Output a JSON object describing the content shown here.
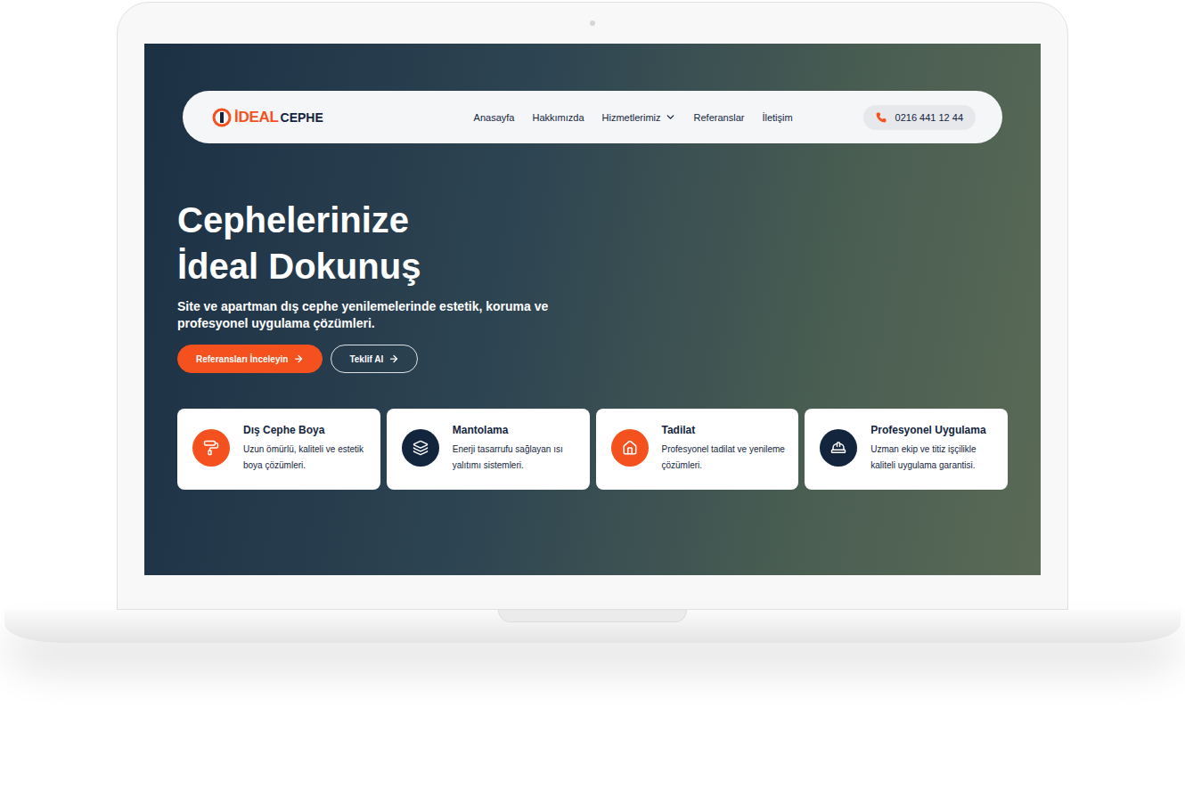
{
  "logo": {
    "primary": "İDEAL",
    "secondary": "CEPHE"
  },
  "nav": {
    "items": [
      {
        "label": "Anasayfa",
        "has_dropdown": false,
        "selected": false
      },
      {
        "label": "Hakkımızda",
        "has_dropdown": false,
        "selected": false
      },
      {
        "label": "Hizmetlerimiz",
        "has_dropdown": true,
        "selected": false
      },
      {
        "label": "Referanslar",
        "has_dropdown": false,
        "selected": false
      },
      {
        "label": "İletişim",
        "has_dropdown": false,
        "selected": false
      }
    ],
    "phone": "0216 441 12 44"
  },
  "hero": {
    "title_lines": [
      "Cephelerinize",
      "İdeal Dokunuş"
    ],
    "subtitle": "Site ve apartman dış cephe yenilemelerinde estetik, koruma ve profesyonel uygulama çözümleri.",
    "buttons": [
      {
        "label": "Referansları İnceleyin",
        "kind": "primary"
      },
      {
        "label": "Teklif Al",
        "kind": "outline"
      }
    ]
  },
  "services": [
    {
      "title": "Dış Cephe Boya",
      "description": "Uzun ömürlü, kaliteli ve estetik boya çözümleri.",
      "color": "#f4511e"
    },
    {
      "title": "Mantolama",
      "description": "Enerji tasarrufu sağlayan ısı yalıtımı sistemleri.",
      "color": "#13253d"
    },
    {
      "title": "Tadilat",
      "description": "Profesyonel tadilat ve yenileme çözümleri.",
      "color": "#f4511e"
    },
    {
      "title": "Profesyonel Uygulama",
      "description": "Uzman ekip ve titiz işçilikle kaliteli uygulama garantisi.",
      "color": "#13253d"
    }
  ]
}
